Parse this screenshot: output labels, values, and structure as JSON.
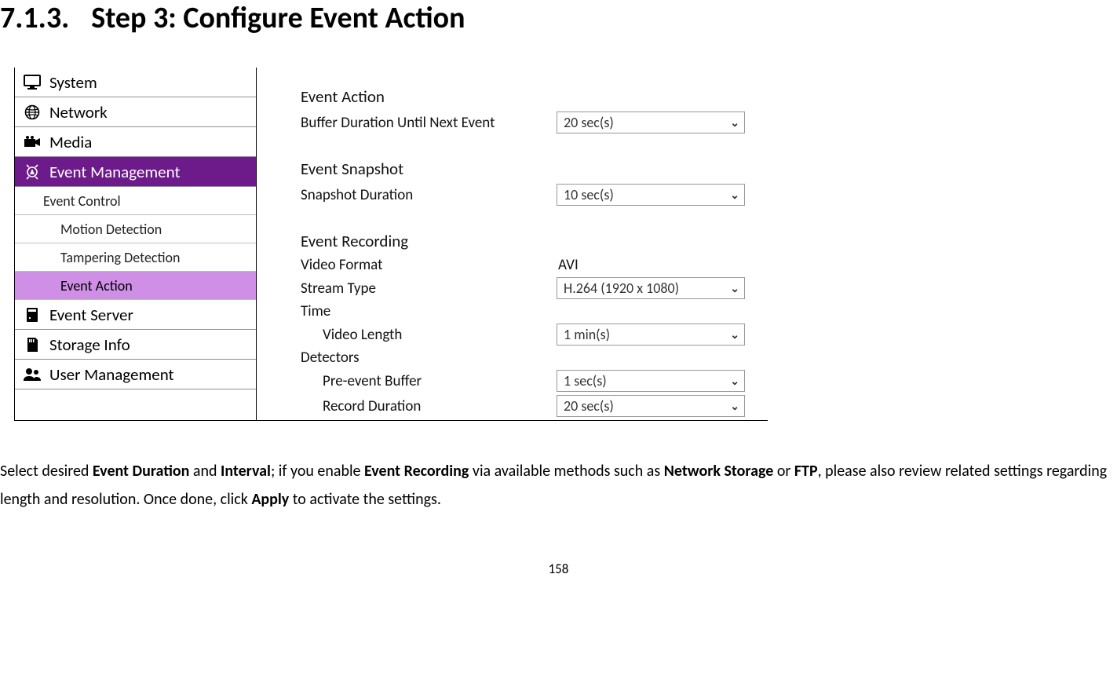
{
  "heading": {
    "number": "7.1.3.",
    "title": "Step 3: Configure Event Action"
  },
  "sidebar": {
    "items": [
      {
        "label": "System"
      },
      {
        "label": "Network"
      },
      {
        "label": "Media"
      },
      {
        "label": "Event Management"
      },
      {
        "label": "Event Server"
      },
      {
        "label": "Storage Info"
      },
      {
        "label": "User Management"
      }
    ],
    "sub": {
      "eventControl": "Event Control",
      "motion": "Motion Detection",
      "tampering": "Tampering Detection",
      "eventAction": "Event Action"
    }
  },
  "content": {
    "eventAction": {
      "heading": "Event Action",
      "bufferLabel": "Buffer Duration Until Next Event",
      "bufferValue": "20 sec(s)"
    },
    "eventSnapshot": {
      "heading": "Event Snapshot",
      "snapLabel": "Snapshot Duration",
      "snapValue": "10 sec(s)"
    },
    "eventRecording": {
      "heading": "Event Recording",
      "videoFormatLabel": "Video Format",
      "videoFormatValue": "AVI",
      "streamTypeLabel": "Stream Type",
      "streamTypeValue": "H.264 (1920 x 1080)",
      "timeLabel": "Time",
      "videoLengthLabel": "Video Length",
      "videoLengthValue": "1 min(s)",
      "detectorsLabel": "Detectors",
      "preEventLabel": "Pre-event Buffer",
      "preEventValue": "1 sec(s)",
      "recordDurationLabel": "Record Duration",
      "recordDurationValue": "20 sec(s)"
    }
  },
  "body": {
    "t1": "Select desired ",
    "b1": "Event Duration",
    "t2": " and ",
    "b2": "Interval",
    "t3": "; if you enable ",
    "b3": "Event Recording",
    "t4": " via available methods such as ",
    "b4": "Network Storage",
    "t5": " or ",
    "b5": "FTP",
    "t6": ", please also review related settings regarding length and resolution.    Once done, click ",
    "b6": "Apply",
    "t7": " to activate the settings."
  },
  "pageNumber": "158"
}
